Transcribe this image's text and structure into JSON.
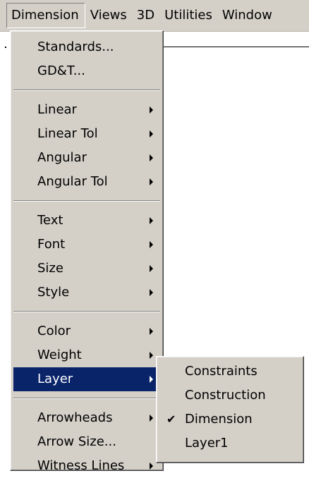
{
  "menubar": {
    "items": [
      {
        "label": "Dimension"
      },
      {
        "label": "Views"
      },
      {
        "label": "3D"
      },
      {
        "label": "Utilities"
      },
      {
        "label": "Window"
      }
    ]
  },
  "dimension_menu": {
    "groups": [
      [
        {
          "label": "Standards..."
        },
        {
          "label": "GD&T..."
        }
      ],
      [
        {
          "label": "Linear",
          "has_submenu": true
        },
        {
          "label": "Linear Tol",
          "has_submenu": true
        },
        {
          "label": "Angular",
          "has_submenu": true
        },
        {
          "label": "Angular Tol",
          "has_submenu": true
        }
      ],
      [
        {
          "label": "Text",
          "has_submenu": true
        },
        {
          "label": "Font",
          "has_submenu": true
        },
        {
          "label": "Size",
          "has_submenu": true
        },
        {
          "label": "Style",
          "has_submenu": true
        }
      ],
      [
        {
          "label": "Color",
          "has_submenu": true
        },
        {
          "label": "Weight",
          "has_submenu": true
        },
        {
          "label": "Layer",
          "has_submenu": true,
          "highlighted": true
        }
      ],
      [
        {
          "label": "Arrowheads",
          "has_submenu": true
        },
        {
          "label": "Arrow Size..."
        },
        {
          "label": "Witness Lines",
          "has_submenu": true
        }
      ]
    ]
  },
  "layer_submenu": {
    "items": [
      {
        "label": "Constraints",
        "checked": false
      },
      {
        "label": "Construction",
        "checked": false
      },
      {
        "label": "Dimension",
        "checked": true
      },
      {
        "label": "Layer1",
        "checked": false
      }
    ]
  },
  "colors": {
    "menu_background": "#d4d0c8",
    "highlight": "#0a246a",
    "highlight_text": "#ffffff"
  },
  "icons": {
    "submenu_arrow": "submenu-arrow-icon",
    "check": "checkmark-icon"
  }
}
